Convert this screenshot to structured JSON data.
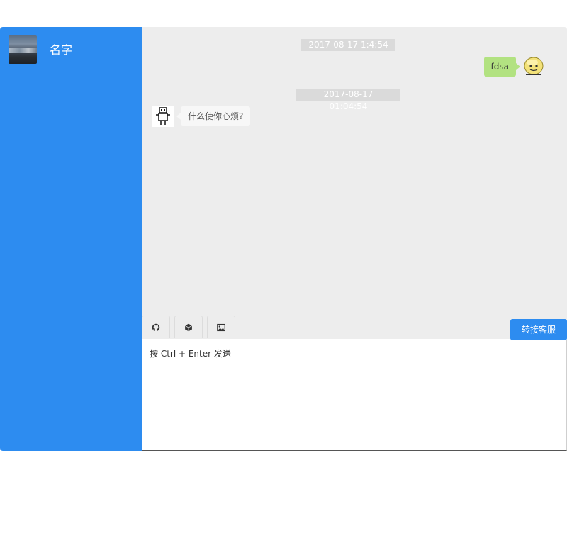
{
  "sidebar": {
    "user": {
      "name": "名字"
    }
  },
  "chat": {
    "messages": [
      {
        "type": "timestamp",
        "text": "2017-08-17 1:4:54"
      },
      {
        "type": "user",
        "text": "fdsa"
      },
      {
        "type": "timestamp",
        "text": "2017-08-17 01:04:54"
      },
      {
        "type": "bot",
        "text": "什么使你心烦?"
      }
    ]
  },
  "toolbar": {
    "tools": [
      {
        "icon": "github-icon"
      },
      {
        "icon": "cube-icon"
      },
      {
        "icon": "image-icon"
      }
    ],
    "transfer_label": "转接客服"
  },
  "input": {
    "placeholder": "按 Ctrl + Enter 发送"
  },
  "colors": {
    "primary": "#2d8cf0",
    "chat_bg": "#ededed",
    "user_bubble": "#b2e281",
    "timestamp_bg": "#dadada"
  }
}
